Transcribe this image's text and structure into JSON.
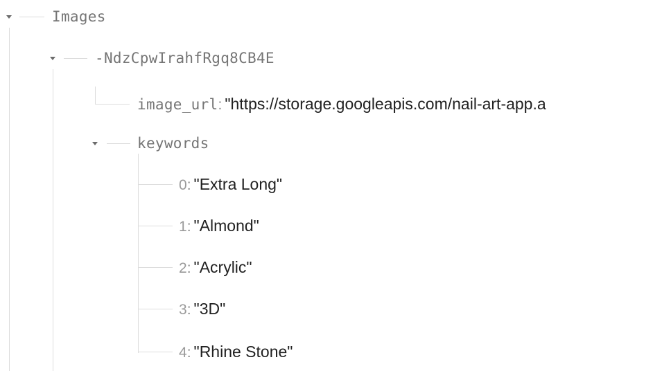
{
  "tree": {
    "root": {
      "key": "Images",
      "child": {
        "key": "-NdzCpwIrahfRgq8CB4E",
        "image_url": {
          "key": "image_url",
          "value": "\"https://storage.googleapis.com/nail-art-app.a"
        },
        "keywords": {
          "key": "keywords",
          "items": [
            {
              "index": "0",
              "value": "\"Extra Long\""
            },
            {
              "index": "1",
              "value": "\"Almond\""
            },
            {
              "index": "2",
              "value": "\"Acrylic\""
            },
            {
              "index": "3",
              "value": "\"3D\""
            },
            {
              "index": "4",
              "value": "\"Rhine Stone\""
            }
          ]
        }
      }
    },
    "colon": ":"
  }
}
